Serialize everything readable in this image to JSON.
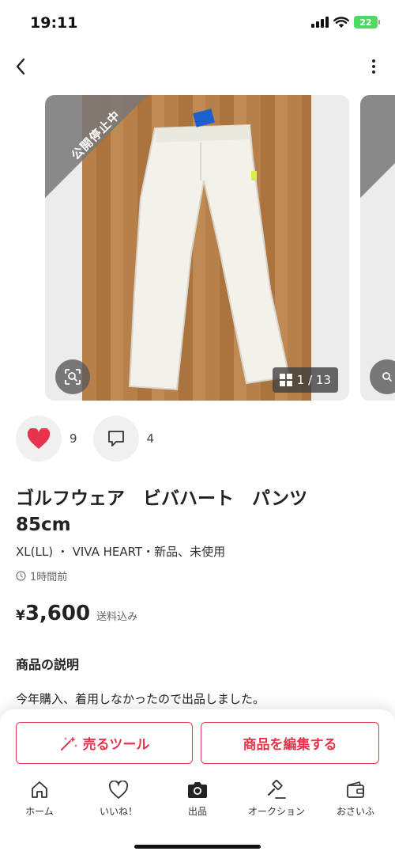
{
  "status_bar": {
    "time": "19:11",
    "battery": "22"
  },
  "product": {
    "image_badge": "公開停止中",
    "image_counter": "1 / 13",
    "likes": "9",
    "comments": "4",
    "title_line1": "ゴルフウェア　ビバハート　パンツ",
    "title_line2": "85cm",
    "meta": "XL(LL) ・ VIVA HEART・新品、未使用",
    "posted": "1時間前",
    "price_currency": "¥",
    "price": "3,600",
    "price_note": "送料込み",
    "description_heading": "商品の説明",
    "description": "今年購入、着用しなかったので出品しました。"
  },
  "actions": {
    "sell_tools": "売るツール",
    "edit_item": "商品を編集する"
  },
  "tabbar": [
    {
      "label": "ホーム",
      "icon": "home-icon"
    },
    {
      "label": "いいね！",
      "icon": "heart-outline-icon"
    },
    {
      "label": "出品",
      "icon": "camera-icon"
    },
    {
      "label": "オークション",
      "icon": "gavel-icon"
    },
    {
      "label": "おさいふ",
      "icon": "wallet-icon"
    }
  ],
  "colors": {
    "accent": "#e8334d",
    "like_red": "#e8334d",
    "badge_gray": "#787878"
  }
}
